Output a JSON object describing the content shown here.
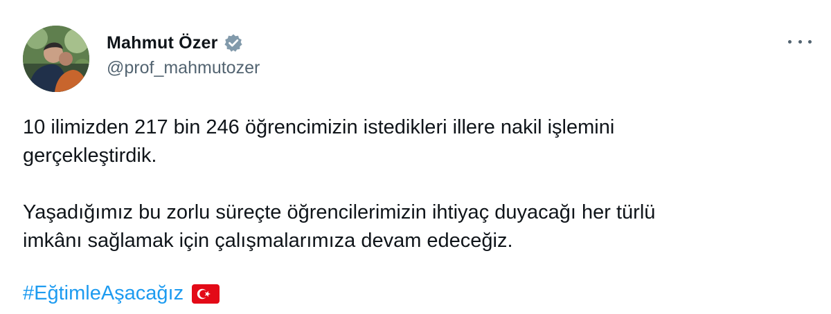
{
  "author": {
    "display_name": "Mahmut Özer",
    "handle": "@prof_mahmutozer",
    "verified": true
  },
  "tweet": {
    "paragraphs": [
      [
        "10 ilimizden 217 bin 246 öğrencimizin istedikleri illere nakil işlemini",
        "gerçekleştirdik."
      ],
      [
        "Yaşadığımız bu zorlu süreçte öğrencilerimizin ihtiyaç duyacağı her türlü",
        "imkânı sağlamak için çalışmalarımıza devam edeceğiz."
      ]
    ],
    "hashtag": "#EğtimleAşacağız",
    "emoji": "turkey-flag-icon"
  },
  "colors": {
    "hashtag": "#1d9bf0",
    "handle": "#536471",
    "verified_badge": "#829aab",
    "flag_red": "#e30a17"
  },
  "icons": {
    "more": "more-options-icon",
    "verified": "verified-badge-icon"
  }
}
